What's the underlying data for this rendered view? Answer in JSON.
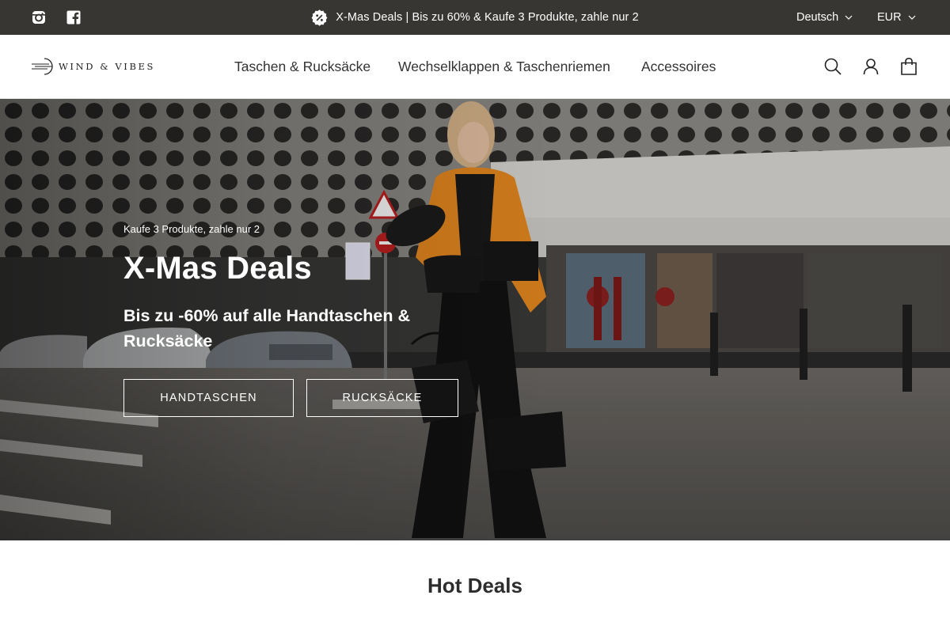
{
  "topbar": {
    "social": [
      {
        "icon": "instagram-icon"
      },
      {
        "icon": "facebook-icon"
      }
    ],
    "announcement": {
      "icon": "discount-badge-icon",
      "text": "X-Mas Deals | Bis zu 60% & Kaufe 3 Produkte, zahle nur 2"
    },
    "language": "Deutsch",
    "currency": "EUR"
  },
  "header": {
    "logo_text": "WIND & VIBES",
    "nav": [
      {
        "label": "Taschen & Rucksäcke"
      },
      {
        "label": "Wechselklappen & Taschenriemen"
      },
      {
        "label": "Accessoires"
      }
    ],
    "icons": [
      "search-icon",
      "account-icon",
      "cart-icon"
    ]
  },
  "hero": {
    "eyebrow": "Kaufe 3 Produkte, zahle nur 2",
    "title": "X-Mas Deals",
    "subtitle": "Bis zu -60% auf alle Handtaschen & Rucksäcke",
    "buttons": [
      {
        "label": "HANDTASCHEN"
      },
      {
        "label": "RUCKSÄCKE"
      }
    ]
  },
  "section": {
    "title": "Hot Deals"
  },
  "colors": {
    "topbar_bg": "#373633",
    "accent_orange": "#e8891f",
    "text_dark": "#2d2d2d"
  }
}
